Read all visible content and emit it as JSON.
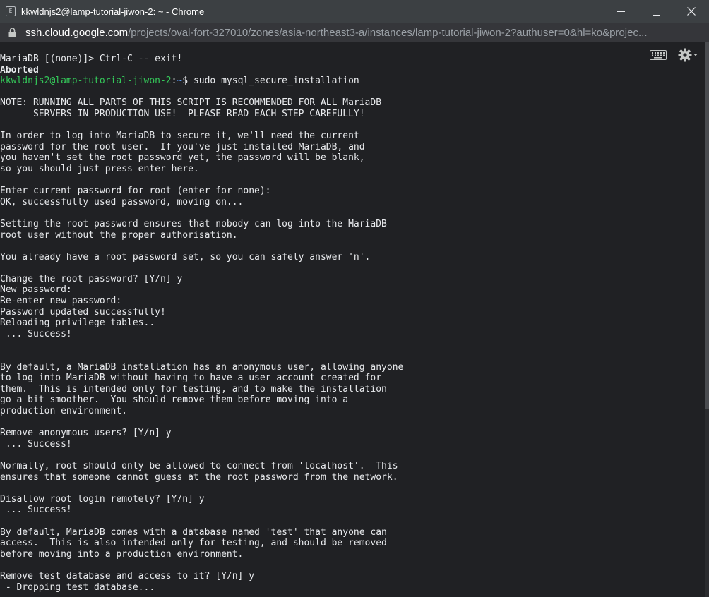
{
  "window": {
    "title": "kkwldnjs2@lamp-tutorial-jiwon-2: ~ - Chrome",
    "app_icon": "terminal-app-icon",
    "app_icon_glyph": "E",
    "controls": [
      "minimize-icon",
      "maximize-icon",
      "close-icon"
    ]
  },
  "address": {
    "host": "ssh.cloud.google.com",
    "path": "/projects/oval-fort-327010/zones/asia-northeast3-a/instances/lamp-tutorial-jiwon-2?authuser=0&hl=ko&projec..."
  },
  "toolbar": {
    "icons": [
      "keyboard-icon",
      "settings-gear-icon"
    ]
  },
  "colors": {
    "terminal_bg": "#202124",
    "prompt_user": "#34c759",
    "prompt_path": "#5ea1ff",
    "text": "#e8eaed"
  },
  "terminal": {
    "prompt_user": "kkwldnjs2@lamp-tutorial-jiwon-2",
    "prompt_sep": ":",
    "prompt_path": "~",
    "prompt_end": "$ ",
    "command": "sudo mysql_secure_installation",
    "lines": [
      "MariaDB [(none)]> Ctrl-C -- exit!",
      "Aborted",
      "",
      "",
      "NOTE: RUNNING ALL PARTS OF THIS SCRIPT IS RECOMMENDED FOR ALL MariaDB",
      "      SERVERS IN PRODUCTION USE!  PLEASE READ EACH STEP CAREFULLY!",
      "",
      "In order to log into MariaDB to secure it, we'll need the current",
      "password for the root user.  If you've just installed MariaDB, and",
      "you haven't set the root password yet, the password will be blank,",
      "so you should just press enter here.",
      "",
      "Enter current password for root (enter for none):",
      "OK, successfully used password, moving on...",
      "",
      "Setting the root password ensures that nobody can log into the MariaDB",
      "root user without the proper authorisation.",
      "",
      "You already have a root password set, so you can safely answer 'n'.",
      "",
      "Change the root password? [Y/n] y",
      "New password:",
      "Re-enter new password:",
      "Password updated successfully!",
      "Reloading privilege tables..",
      " ... Success!",
      "",
      "",
      "By default, a MariaDB installation has an anonymous user, allowing anyone",
      "to log into MariaDB without having to have a user account created for",
      "them.  This is intended only for testing, and to make the installation",
      "go a bit smoother.  You should remove them before moving into a",
      "production environment.",
      "",
      "Remove anonymous users? [Y/n] y",
      " ... Success!",
      "",
      "Normally, root should only be allowed to connect from 'localhost'.  This",
      "ensures that someone cannot guess at the root password from the network.",
      "",
      "Disallow root login remotely? [Y/n] y",
      " ... Success!",
      "",
      "By default, MariaDB comes with a database named 'test' that anyone can",
      "access.  This is also intended only for testing, and should be removed",
      "before moving into a production environment.",
      "",
      "Remove test database and access to it? [Y/n] y",
      " - Dropping test database..."
    ]
  }
}
